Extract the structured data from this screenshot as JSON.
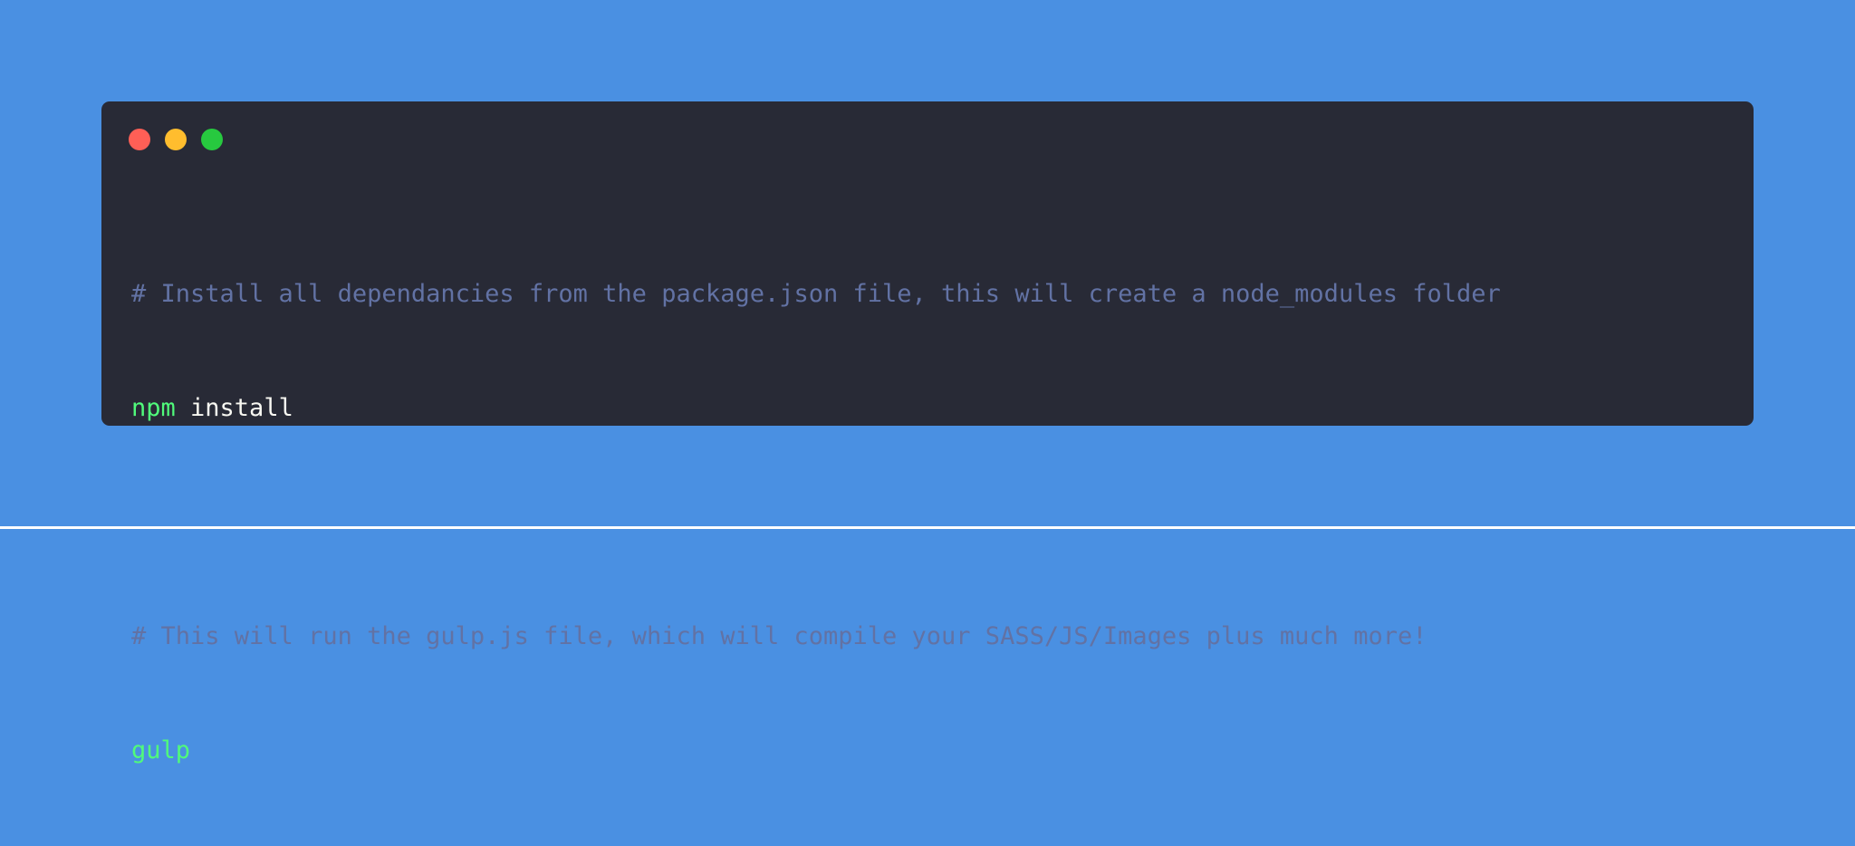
{
  "colors": {
    "background": "#4a90e2",
    "window": "#282a36",
    "comment": "#6272a4",
    "command": "#50fa7b",
    "text": "#f8f8f2",
    "dot_close": "#ff5f56",
    "dot_minimize": "#ffbd2e",
    "dot_maximize": "#27c93f"
  },
  "window_controls": {
    "close": "close-dot",
    "minimize": "minimize-dot",
    "maximize": "maximize-dot"
  },
  "code": {
    "line1_comment": "# Install all dependancies from the package.json file, this will create a node_modules folder",
    "line2_command": "npm",
    "line2_rest": " install",
    "line4_comment": "# This will run the gulp.js file, which will compile your SASS/JS/Images plus much more!",
    "line5_command": "gulp"
  }
}
